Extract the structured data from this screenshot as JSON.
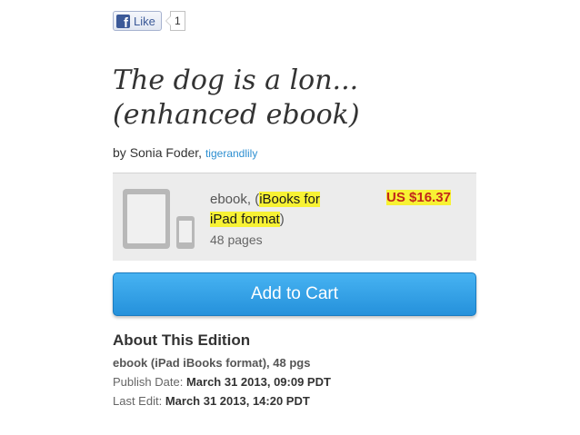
{
  "facebook": {
    "like_label": "Like",
    "like_count": "1",
    "logo_letter": "f"
  },
  "book": {
    "title_line1": "The dog is a lon...",
    "title_line2": "(enhanced ebook)",
    "by_prefix": "by",
    "author": "Sonia Foder,",
    "username": "tigerandlily"
  },
  "format": {
    "type_prefix": "ebook, (",
    "format_name_1": "iBooks for",
    "format_name_2": "iPad format",
    "type_suffix": ")",
    "pages": "48 pages",
    "price": "US $16.37",
    "highlight_color": "#f7f234",
    "price_color": "#c2271a"
  },
  "cart": {
    "button_label": "Add to Cart",
    "button_color": "#2d9be2"
  },
  "about": {
    "heading": "About This Edition",
    "edition": "ebook (iPad iBooks format), 48 pgs",
    "publish_label": "Publish Date:",
    "publish_value": "March 31 2013, 09:09 PDT",
    "edit_label": "Last Edit:",
    "edit_value": "March 31 2013, 14:20 PDT"
  }
}
